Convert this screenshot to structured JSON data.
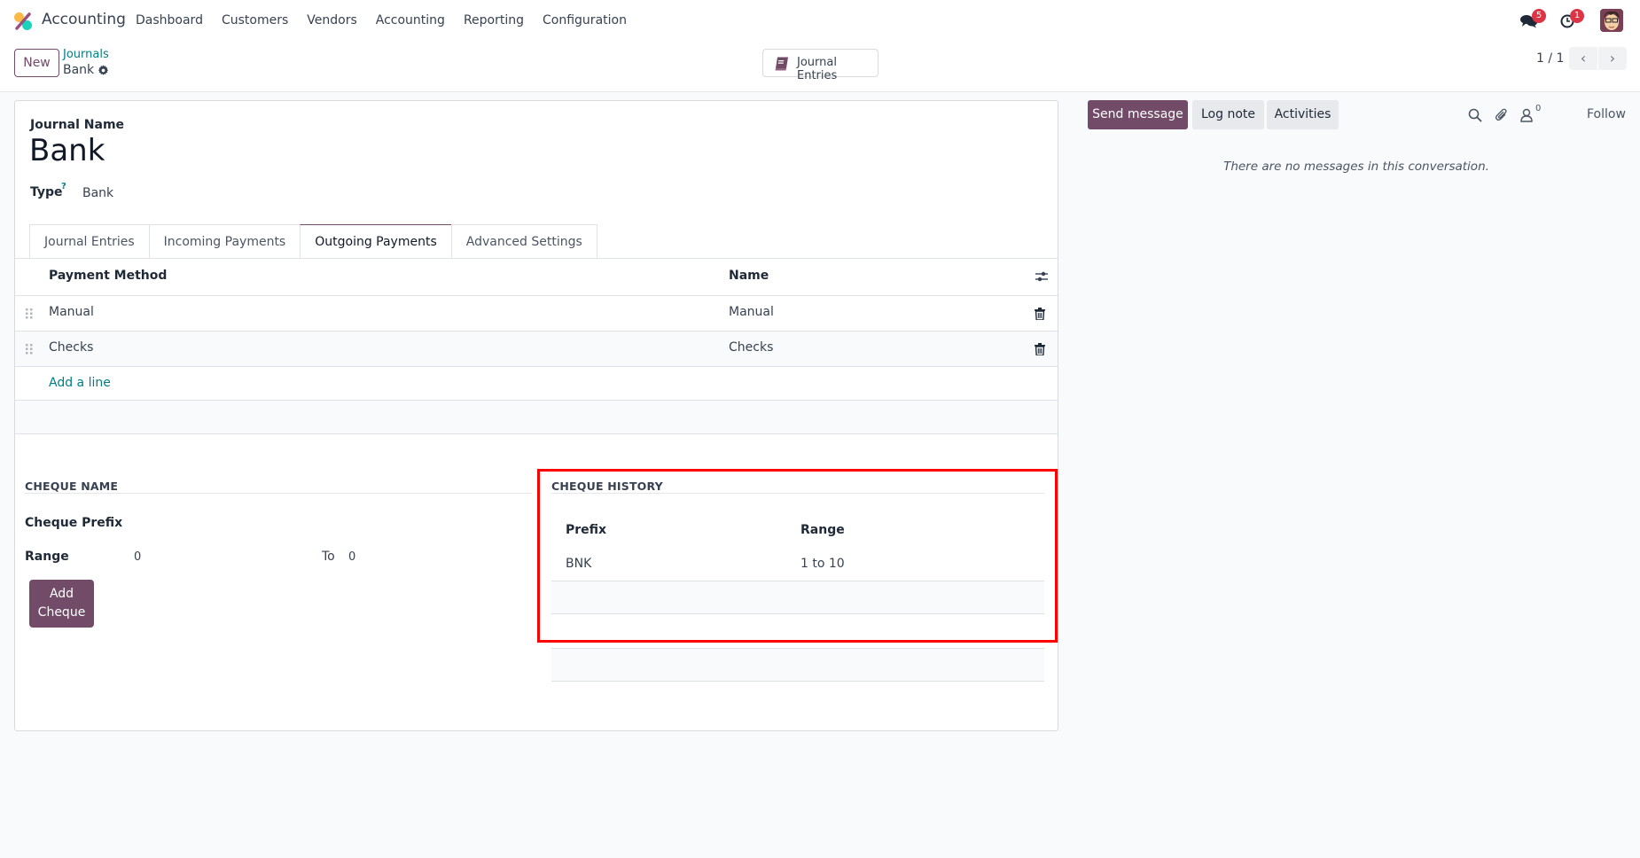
{
  "navbar": {
    "app_name": "Accounting",
    "menu": [
      "Dashboard",
      "Customers",
      "Vendors",
      "Accounting",
      "Reporting",
      "Configuration"
    ],
    "messages_badge": "5",
    "activities_badge": "1",
    "icons": [
      "discuss-icon",
      "clock-icon",
      "avatar"
    ]
  },
  "control_panel": {
    "new_label": "New",
    "breadcrumb_parent": "Journals",
    "breadcrumb_current": "Bank",
    "smart_button_label": "Journal Entries",
    "pager_value": "1 / 1",
    "pager_prev": "‹",
    "pager_next": "›"
  },
  "form": {
    "journal_name_label": "Journal Name",
    "journal_name": "Bank",
    "type_label": "Type",
    "type_help": "?",
    "type_value": "Bank",
    "tabs": [
      {
        "label": "Journal Entries",
        "active": false
      },
      {
        "label": "Incoming Payments",
        "active": false
      },
      {
        "label": "Outgoing Payments",
        "active": true
      },
      {
        "label": "Advanced Settings",
        "active": false
      }
    ],
    "payment_table": {
      "headers": [
        "Payment Method",
        "Name"
      ],
      "rows": [
        {
          "method": "Manual",
          "name": "Manual"
        },
        {
          "method": "Checks",
          "name": "Checks"
        }
      ],
      "add_line_label": "Add a line"
    },
    "cheque_name": {
      "section_title": "CHEQUE NAME",
      "prefix_label": "Cheque Prefix",
      "prefix_value": "",
      "range_label": "Range",
      "range_from": "0",
      "range_to_label": "To",
      "range_to": "0",
      "add_button_line1": "Add",
      "add_button_line2": "Cheque"
    },
    "cheque_history": {
      "section_title": "CHEQUE HISTORY",
      "headers": [
        "Prefix",
        "Range"
      ],
      "rows": [
        {
          "prefix": "BNK",
          "range": "1 to 10"
        }
      ]
    }
  },
  "chatter": {
    "send_message_label": "Send message",
    "log_note_label": "Log note",
    "activities_label": "Activities",
    "followers_count": "0",
    "follow_label": "Follow",
    "empty_message": "There are no messages in this conversation."
  },
  "colors": {
    "brand": "#714b67",
    "link": "#017e84",
    "badge": "#dc3545",
    "highlight_box": "#ff0000"
  }
}
